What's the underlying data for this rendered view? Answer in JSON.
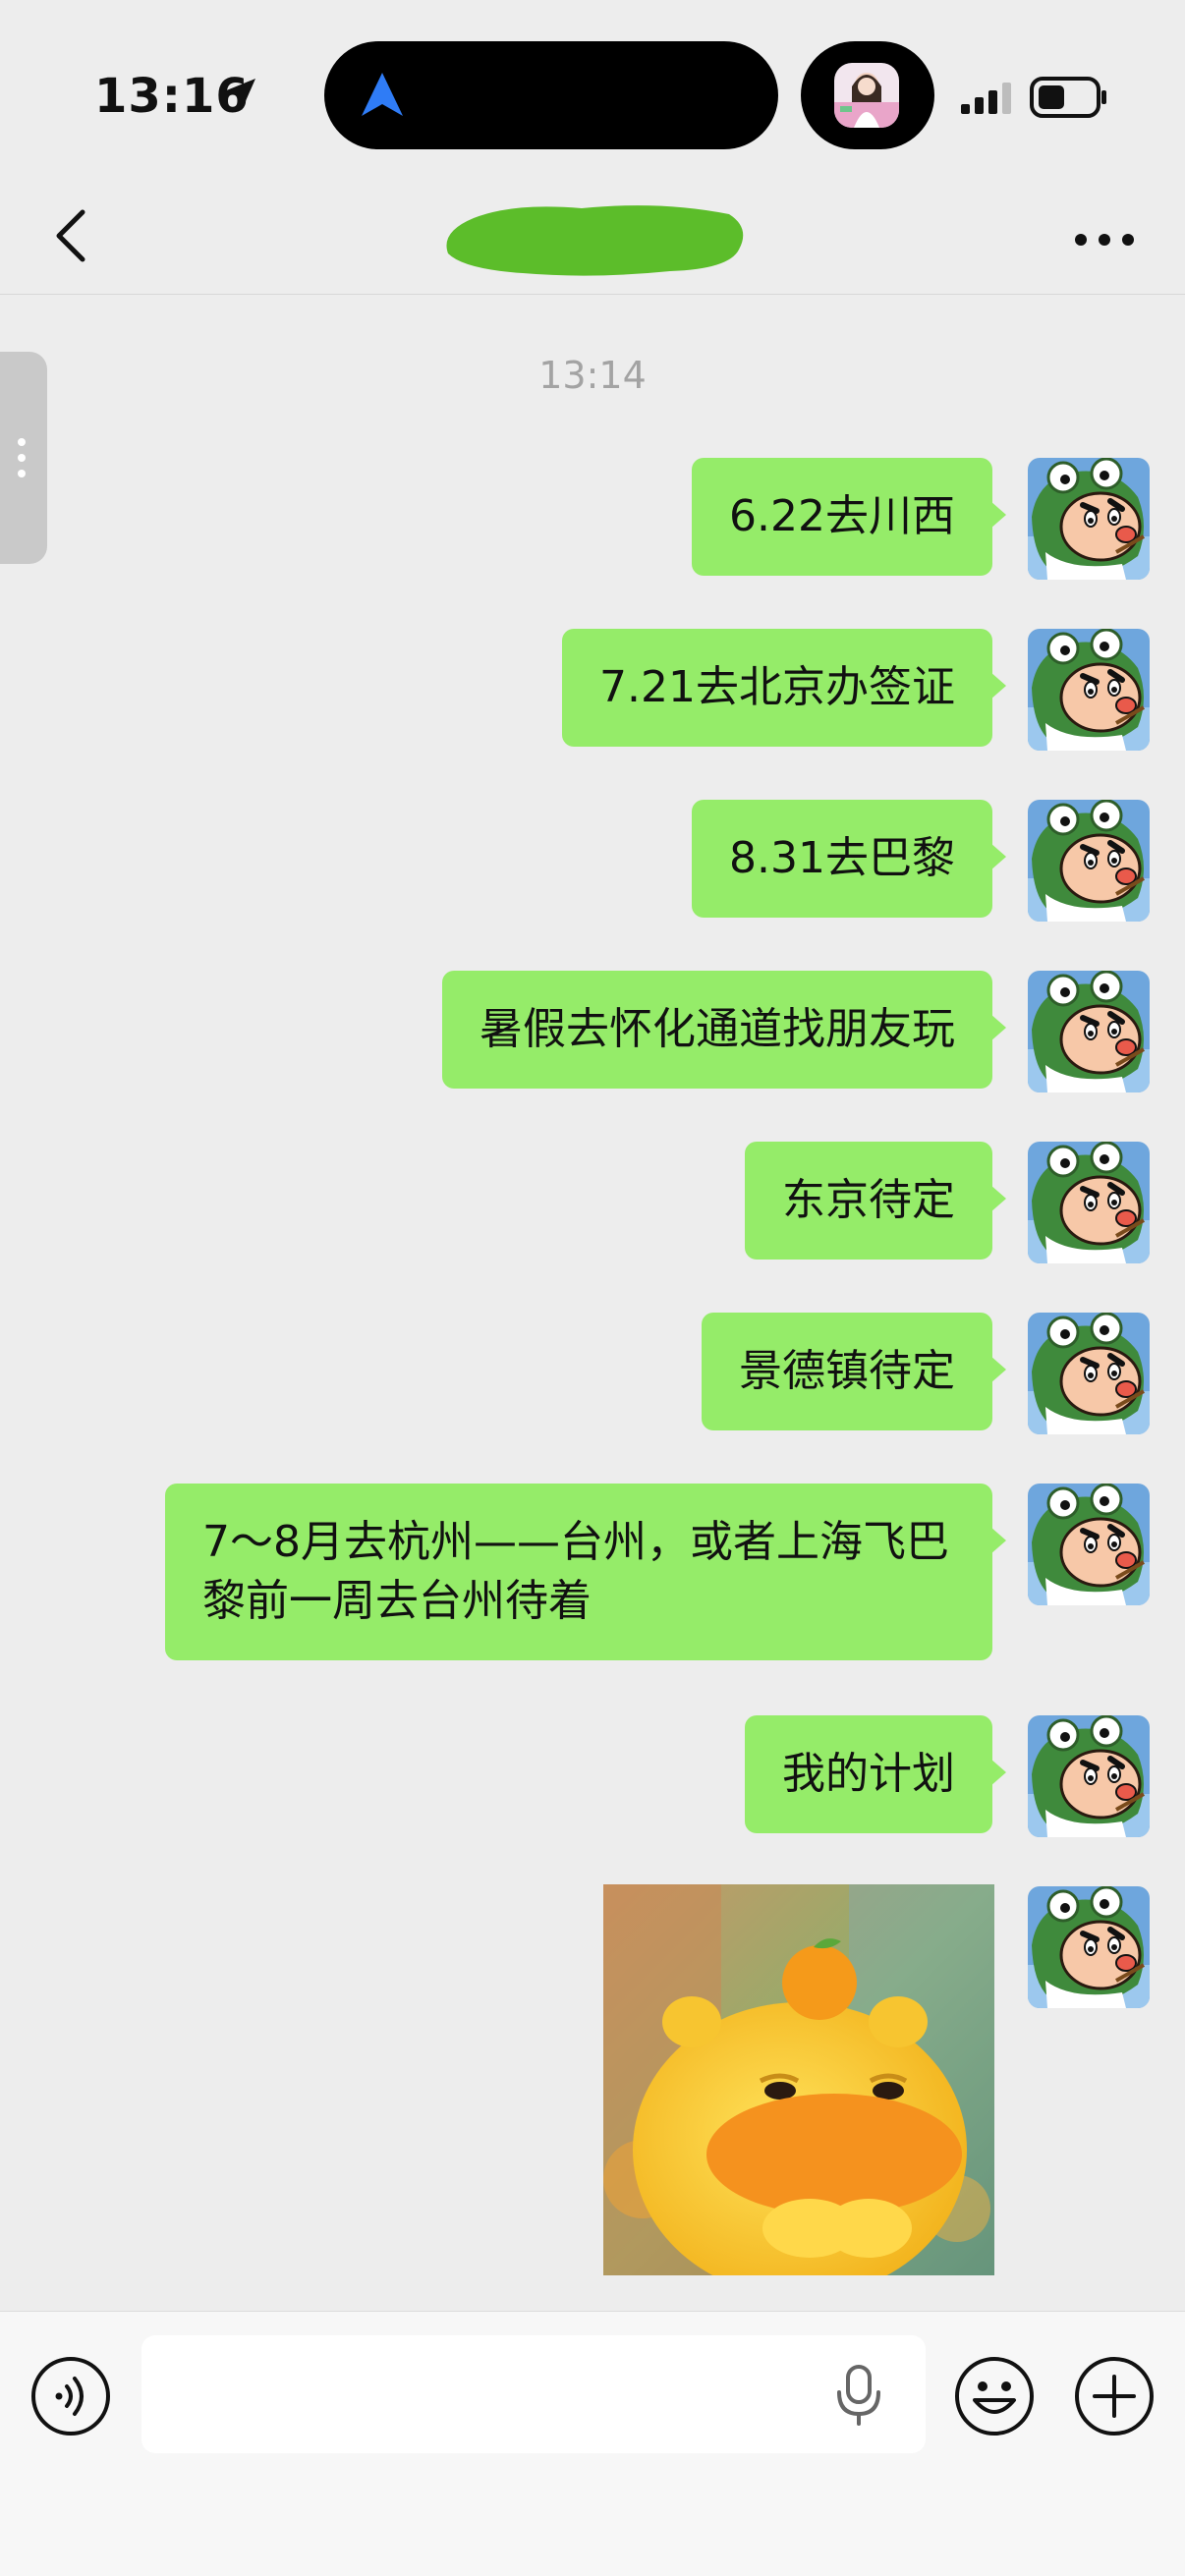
{
  "status_bar": {
    "time": "13:16",
    "icons": [
      "location-arrow-icon",
      "navigation-icon",
      "cellular-signal-icon",
      "battery-icon"
    ]
  },
  "nav": {
    "back_icon": "chevron-left-icon",
    "title_redacted": true,
    "more_icon": "ellipsis-icon"
  },
  "chat": {
    "timestamp": "13:14",
    "messages": [
      {
        "text": "6.22去川西"
      },
      {
        "text": "7.21去北京办签证"
      },
      {
        "text": "8.31去巴黎"
      },
      {
        "text": "暑假去怀化通道找朋友玩"
      },
      {
        "text": "东京待定"
      },
      {
        "text": "景德镇待定"
      },
      {
        "text": "7～8月去杭州——台州，或者上海飞巴黎前一周去台州待着"
      },
      {
        "text": "我的计划"
      }
    ],
    "sticker": "yellow-cartoon-sticker"
  },
  "input_bar": {
    "placeholder": "",
    "icons": [
      "voice-icon",
      "microphone-icon",
      "emoji-icon",
      "plus-icon"
    ]
  },
  "colors": {
    "background": "#ededed",
    "bubble_green": "#95ec69",
    "title_redaction": "#5cbd2a"
  }
}
